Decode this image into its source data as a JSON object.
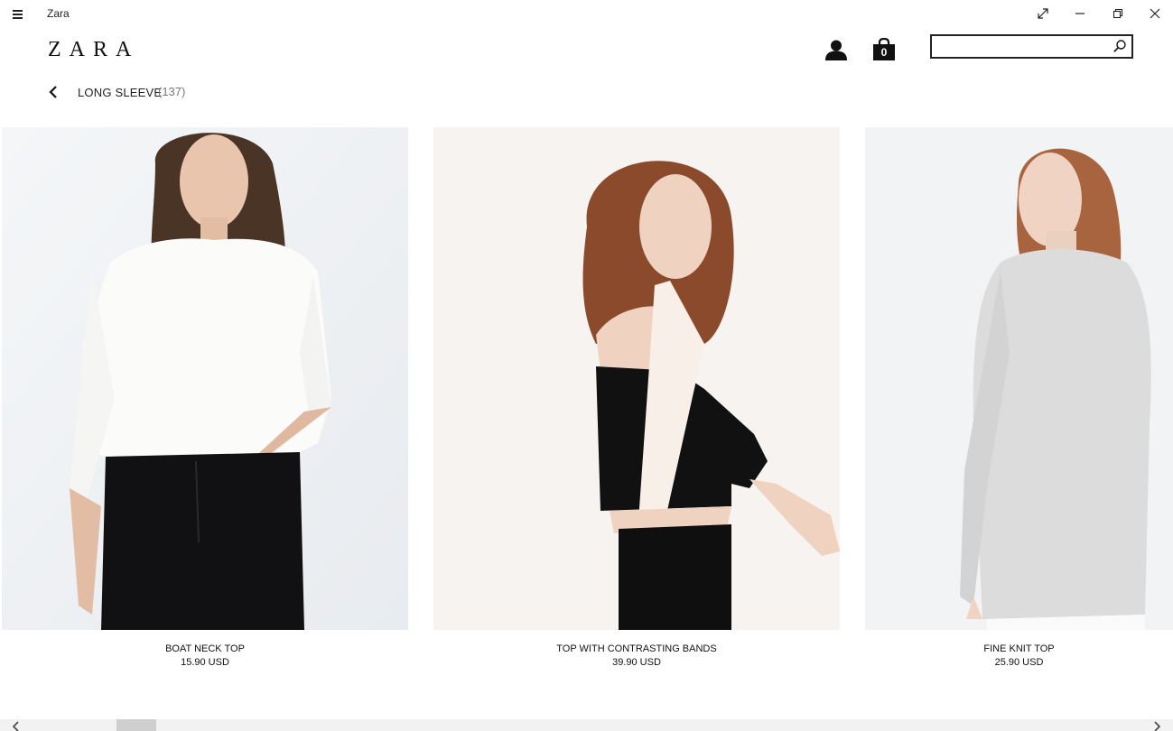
{
  "window": {
    "title": "Zara",
    "controls": [
      "full-screen",
      "minimize",
      "restore",
      "close"
    ]
  },
  "header": {
    "logo": "ZARA",
    "cart_count": "0",
    "search": {
      "value": "",
      "placeholder": ""
    }
  },
  "breadcrumb": {
    "title": "LONG SLEEVE",
    "count": "(137)"
  },
  "products": [
    {
      "name": "BOAT NECK TOP",
      "price": "15.90 USD"
    },
    {
      "name": "TOP WITH CONTRASTING BANDS",
      "price": "39.90 USD"
    },
    {
      "name": "FINE KNIT TOP",
      "price": "25.90 USD"
    }
  ],
  "scrollbar": {
    "position_fraction": 0.1
  },
  "icons": [
    "hamburger-icon",
    "fullscreen-icon",
    "minimize-icon",
    "restore-icon",
    "close-icon",
    "user-icon",
    "shopping-bag-icon",
    "search-icon",
    "back-arrow-icon",
    "chevron-left-icon",
    "chevron-right-icon"
  ],
  "colors": {
    "text": "#111111",
    "muted": "#777777",
    "background": "#ffffff",
    "scroll_track": "#f2f2f2",
    "scroll_thumb": "#cfcfcf"
  }
}
